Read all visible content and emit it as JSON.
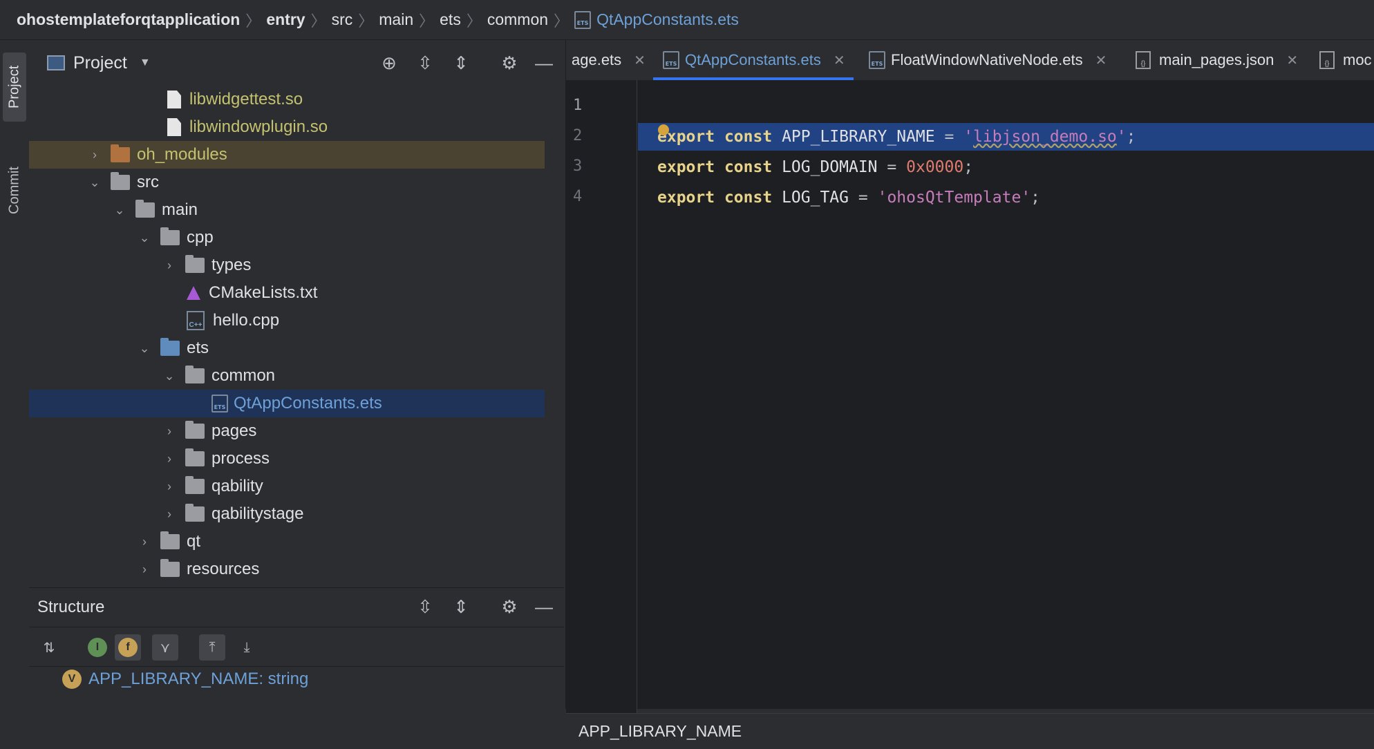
{
  "breadcrumb": {
    "items": [
      "ohostemplateforqtapplication",
      "entry",
      "src",
      "main",
      "ets",
      "common"
    ],
    "file": "QtAppConstants.ets",
    "file_icon_text": "ETS"
  },
  "left_strip": {
    "project": "Project",
    "commit": "Commit"
  },
  "project_panel": {
    "title": "Project",
    "tree": [
      {
        "label": "libwidgettest.so"
      },
      {
        "label": "libwindowplugin.so"
      },
      {
        "label": "oh_modules"
      },
      {
        "label": "src"
      },
      {
        "label": "main"
      },
      {
        "label": "cpp"
      },
      {
        "label": "types"
      },
      {
        "label": "CMakeLists.txt"
      },
      {
        "label": "hello.cpp",
        "icon_text": "C++"
      },
      {
        "label": "ets"
      },
      {
        "label": "common"
      },
      {
        "label": "QtAppConstants.ets",
        "icon_text": "ETS"
      },
      {
        "label": "pages"
      },
      {
        "label": "process"
      },
      {
        "label": "qability"
      },
      {
        "label": "qabilitystage"
      },
      {
        "label": "qt"
      },
      {
        "label": "resources"
      }
    ]
  },
  "structure_panel": {
    "title": "Structure",
    "item_badge": "V",
    "item_label": "APP_LIBRARY_NAME: string",
    "badges": {
      "i": "I",
      "f": "f"
    }
  },
  "editor": {
    "tabs": [
      {
        "label": "age.ets"
      },
      {
        "label": "QtAppConstants.ets",
        "icon_text": "ETS"
      },
      {
        "label": "FloatWindowNativeNode.ets",
        "icon_text": "ETS"
      },
      {
        "label": "main_pages.json",
        "icon_text": "{}"
      },
      {
        "label": "moc",
        "icon_text": "{}"
      }
    ],
    "line_numbers": [
      "1",
      "2",
      "3",
      "4"
    ],
    "lines": [
      {
        "kw1": "export",
        "kw2": "const",
        "name": "APP_LIBRARY_NAME",
        "op": "=",
        "quote_open": "'",
        "value": "libjson_demo.so",
        "quote_close": "'",
        "end": ";"
      },
      {
        "kw1": "export",
        "kw2": "const",
        "name": "LOG_DOMAIN",
        "op": "=",
        "value": "0x0000",
        "end": ";"
      },
      {
        "kw1": "export",
        "kw2": "const",
        "name": "LOG_TAG",
        "op": "=",
        "quote_open": "'",
        "value": "ohosQtTemplate",
        "quote_close": "'",
        "end": ";"
      }
    ],
    "status": "APP_LIBRARY_NAME"
  },
  "colors": {
    "accent": "#3574f0",
    "selection": "#214283",
    "keyword": "#cf8e6d",
    "string": "#c77dbb",
    "number": "#e07c6f"
  }
}
